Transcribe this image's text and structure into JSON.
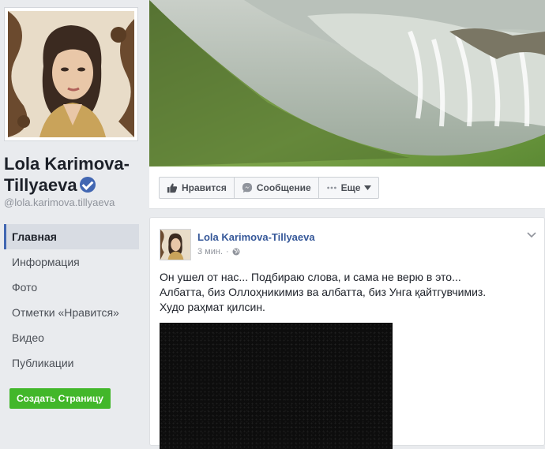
{
  "page": {
    "name_line1": "Lola Karimova-",
    "name_line2": "Tillyaeva",
    "handle": "@lola.karimova.tillyaeva"
  },
  "nav": {
    "items": [
      {
        "label": "Главная",
        "active": true
      },
      {
        "label": "Информация",
        "active": false
      },
      {
        "label": "Фото",
        "active": false
      },
      {
        "label": "Отметки «Нравится»",
        "active": false
      },
      {
        "label": "Видео",
        "active": false
      },
      {
        "label": "Публикации",
        "active": false
      }
    ]
  },
  "create_page_label": "Создать Страницу",
  "actions": {
    "like_label": "Нравится",
    "message_label": "Сообщение",
    "more_label": "Еще"
  },
  "post": {
    "author": "Lola Karimova-Tillyaeva",
    "time": "3 мин.",
    "separator": "·",
    "text_lines": [
      "Он ушел от нас... Подбираю слова, и сама не верю в это...",
      "Албатта, биз Оллоҳникимиз ва албатта, биз Унга қайтгувчимиз.",
      "Худо раҳмат қилсин."
    ]
  },
  "icons": {
    "verified": "verified-badge-icon",
    "like": "thumbs-up-icon",
    "message": "messenger-icon",
    "more": "ellipsis-icon",
    "menu": "chevron-down-icon",
    "audience": "globe-icon"
  },
  "colors": {
    "brand_blue": "#4267b2",
    "link_blue": "#365899",
    "create_green": "#42b72a",
    "background": "#e9ebee"
  }
}
